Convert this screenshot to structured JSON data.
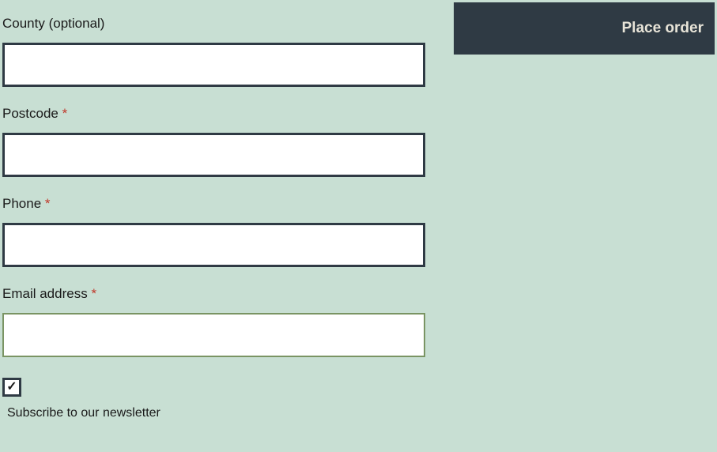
{
  "form": {
    "county": {
      "label": "County ",
      "optional_text": "(optional)",
      "value": ""
    },
    "postcode": {
      "label": "Postcode ",
      "required_mark": "*",
      "value": ""
    },
    "phone": {
      "label": "Phone ",
      "required_mark": "*",
      "value": ""
    },
    "email": {
      "label": "Email address ",
      "required_mark": "*",
      "value": ""
    },
    "newsletter": {
      "label": "Subscribe to our newsletter",
      "checked_mark": "✓"
    }
  },
  "actions": {
    "place_order_label": "Place order"
  }
}
